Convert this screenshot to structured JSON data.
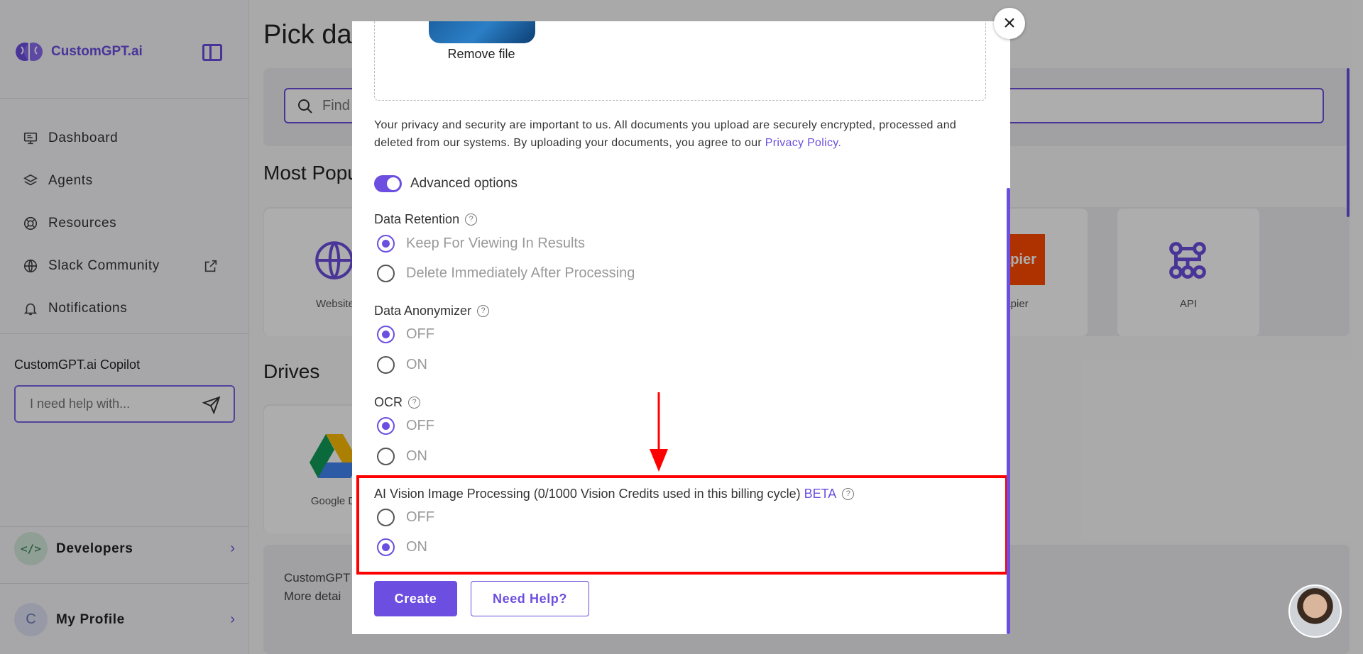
{
  "brand": {
    "name": "CustomGPT.ai"
  },
  "nav": {
    "items": [
      {
        "label": "Dashboard",
        "icon": "monitor-icon"
      },
      {
        "label": "Agents",
        "icon": "layers-icon"
      },
      {
        "label": "Resources",
        "icon": "lifebuoy-icon"
      },
      {
        "label": "Slack Community",
        "icon": "globe-icon"
      },
      {
        "label": "Notifications",
        "icon": "bell-icon"
      }
    ]
  },
  "copilot": {
    "title": "CustomGPT.ai Copilot",
    "placeholder": "I need help with..."
  },
  "developers": {
    "label": "Developers"
  },
  "profile": {
    "label": "My Profile",
    "initial": "C"
  },
  "main": {
    "title": "Pick da",
    "search_placeholder": "Find",
    "most_popular": "Most Popu",
    "drives": "Drives",
    "cards": {
      "website": "Website",
      "zapier": "apier",
      "zapier_logo": "apier",
      "api": "API",
      "google": "Google Dr"
    },
    "info_line1": "CustomGPT",
    "info_line2": "More detai"
  },
  "modal": {
    "remove_file": "Remove file",
    "privacy_text": "Your privacy and security are important to us. All documents you upload are securely encrypted, processed and deleted from our systems. By uploading your documents, you agree to our ",
    "privacy_link": "Privacy Policy",
    "privacy_end": ".",
    "advanced_options": "Advanced options",
    "data_retention": {
      "title": "Data Retention",
      "options": [
        "Keep For Viewing In Results",
        "Delete Immediately After Processing"
      ],
      "selected": 0
    },
    "data_anonymizer": {
      "title": "Data Anonymizer",
      "options": [
        "OFF",
        "ON"
      ],
      "selected": 0
    },
    "ocr": {
      "title": "OCR",
      "options": [
        "OFF",
        "ON"
      ],
      "selected": 0
    },
    "ai_vision": {
      "title": "AI Vision Image Processing (0/1000 Vision Credits used in this billing cycle)",
      "badge": "BETA",
      "options": [
        "OFF",
        "ON"
      ],
      "selected": 1
    },
    "help_glyph": "?",
    "create_label": "Create",
    "help_label": "Need Help?",
    "close_glyph": "×"
  },
  "colors": {
    "accent": "#6c4ee0",
    "highlight": "#ff0000"
  }
}
